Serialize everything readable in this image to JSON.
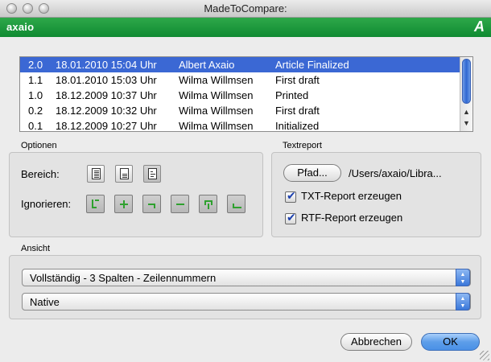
{
  "window": {
    "title": "MadeToCompare:"
  },
  "brand": {
    "name": "axaio",
    "logo": "A"
  },
  "versions": {
    "rows": [
      {
        "version": "2.0",
        "date": "18.01.2010 15:04 Uhr",
        "author": "Albert Axaio",
        "note": "Article Finalized",
        "selected": true
      },
      {
        "version": "1.1",
        "date": "18.01.2010 15:03 Uhr",
        "author": "Wilma Willmsen",
        "note": "First draft",
        "selected": false
      },
      {
        "version": "1.0",
        "date": "18.12.2009 10:37 Uhr",
        "author": "Wilma Willmsen",
        "note": "Printed",
        "selected": false
      },
      {
        "version": "0.2",
        "date": "18.12.2009 10:32 Uhr",
        "author": "Wilma Willmsen",
        "note": "First draft",
        "selected": false
      },
      {
        "version": "0.1",
        "date": "18.12.2009 10:27 Uhr",
        "author": "Wilma Willmsen",
        "note": "Initialized",
        "selected": false
      }
    ]
  },
  "optionen": {
    "label": "Optionen",
    "bereich_label": "Bereich:",
    "ignorieren_label": "Ignorieren:",
    "bereich_icons": [
      "document-full-icon",
      "document-partial-icon",
      "document-selection-icon"
    ],
    "ignore_icons": [
      "ignore-step-icon",
      "ignore-plus-icon",
      "ignore-corner-icon",
      "ignore-minus-icon",
      "ignore-return-icon",
      "ignore-underline-icon"
    ]
  },
  "textreport": {
    "label": "Textreport",
    "path_button": "Pfad...",
    "path_value": "/Users/axaio/Libra...",
    "txt_label": "TXT-Report erzeugen",
    "txt_checked": true,
    "rtf_label": "RTF-Report erzeugen",
    "rtf_checked": true
  },
  "ansicht": {
    "label": "Ansicht",
    "view_mode": "Vollständig - 3 Spalten - Zeilennummern",
    "render_mode": "Native"
  },
  "footer": {
    "cancel": "Abbrechen",
    "ok": "OK"
  },
  "colors": {
    "brand_green": "#17923a",
    "selection_blue": "#3b68d4",
    "check_blue": "#1b3fae",
    "icon_green": "#2fa12f"
  }
}
